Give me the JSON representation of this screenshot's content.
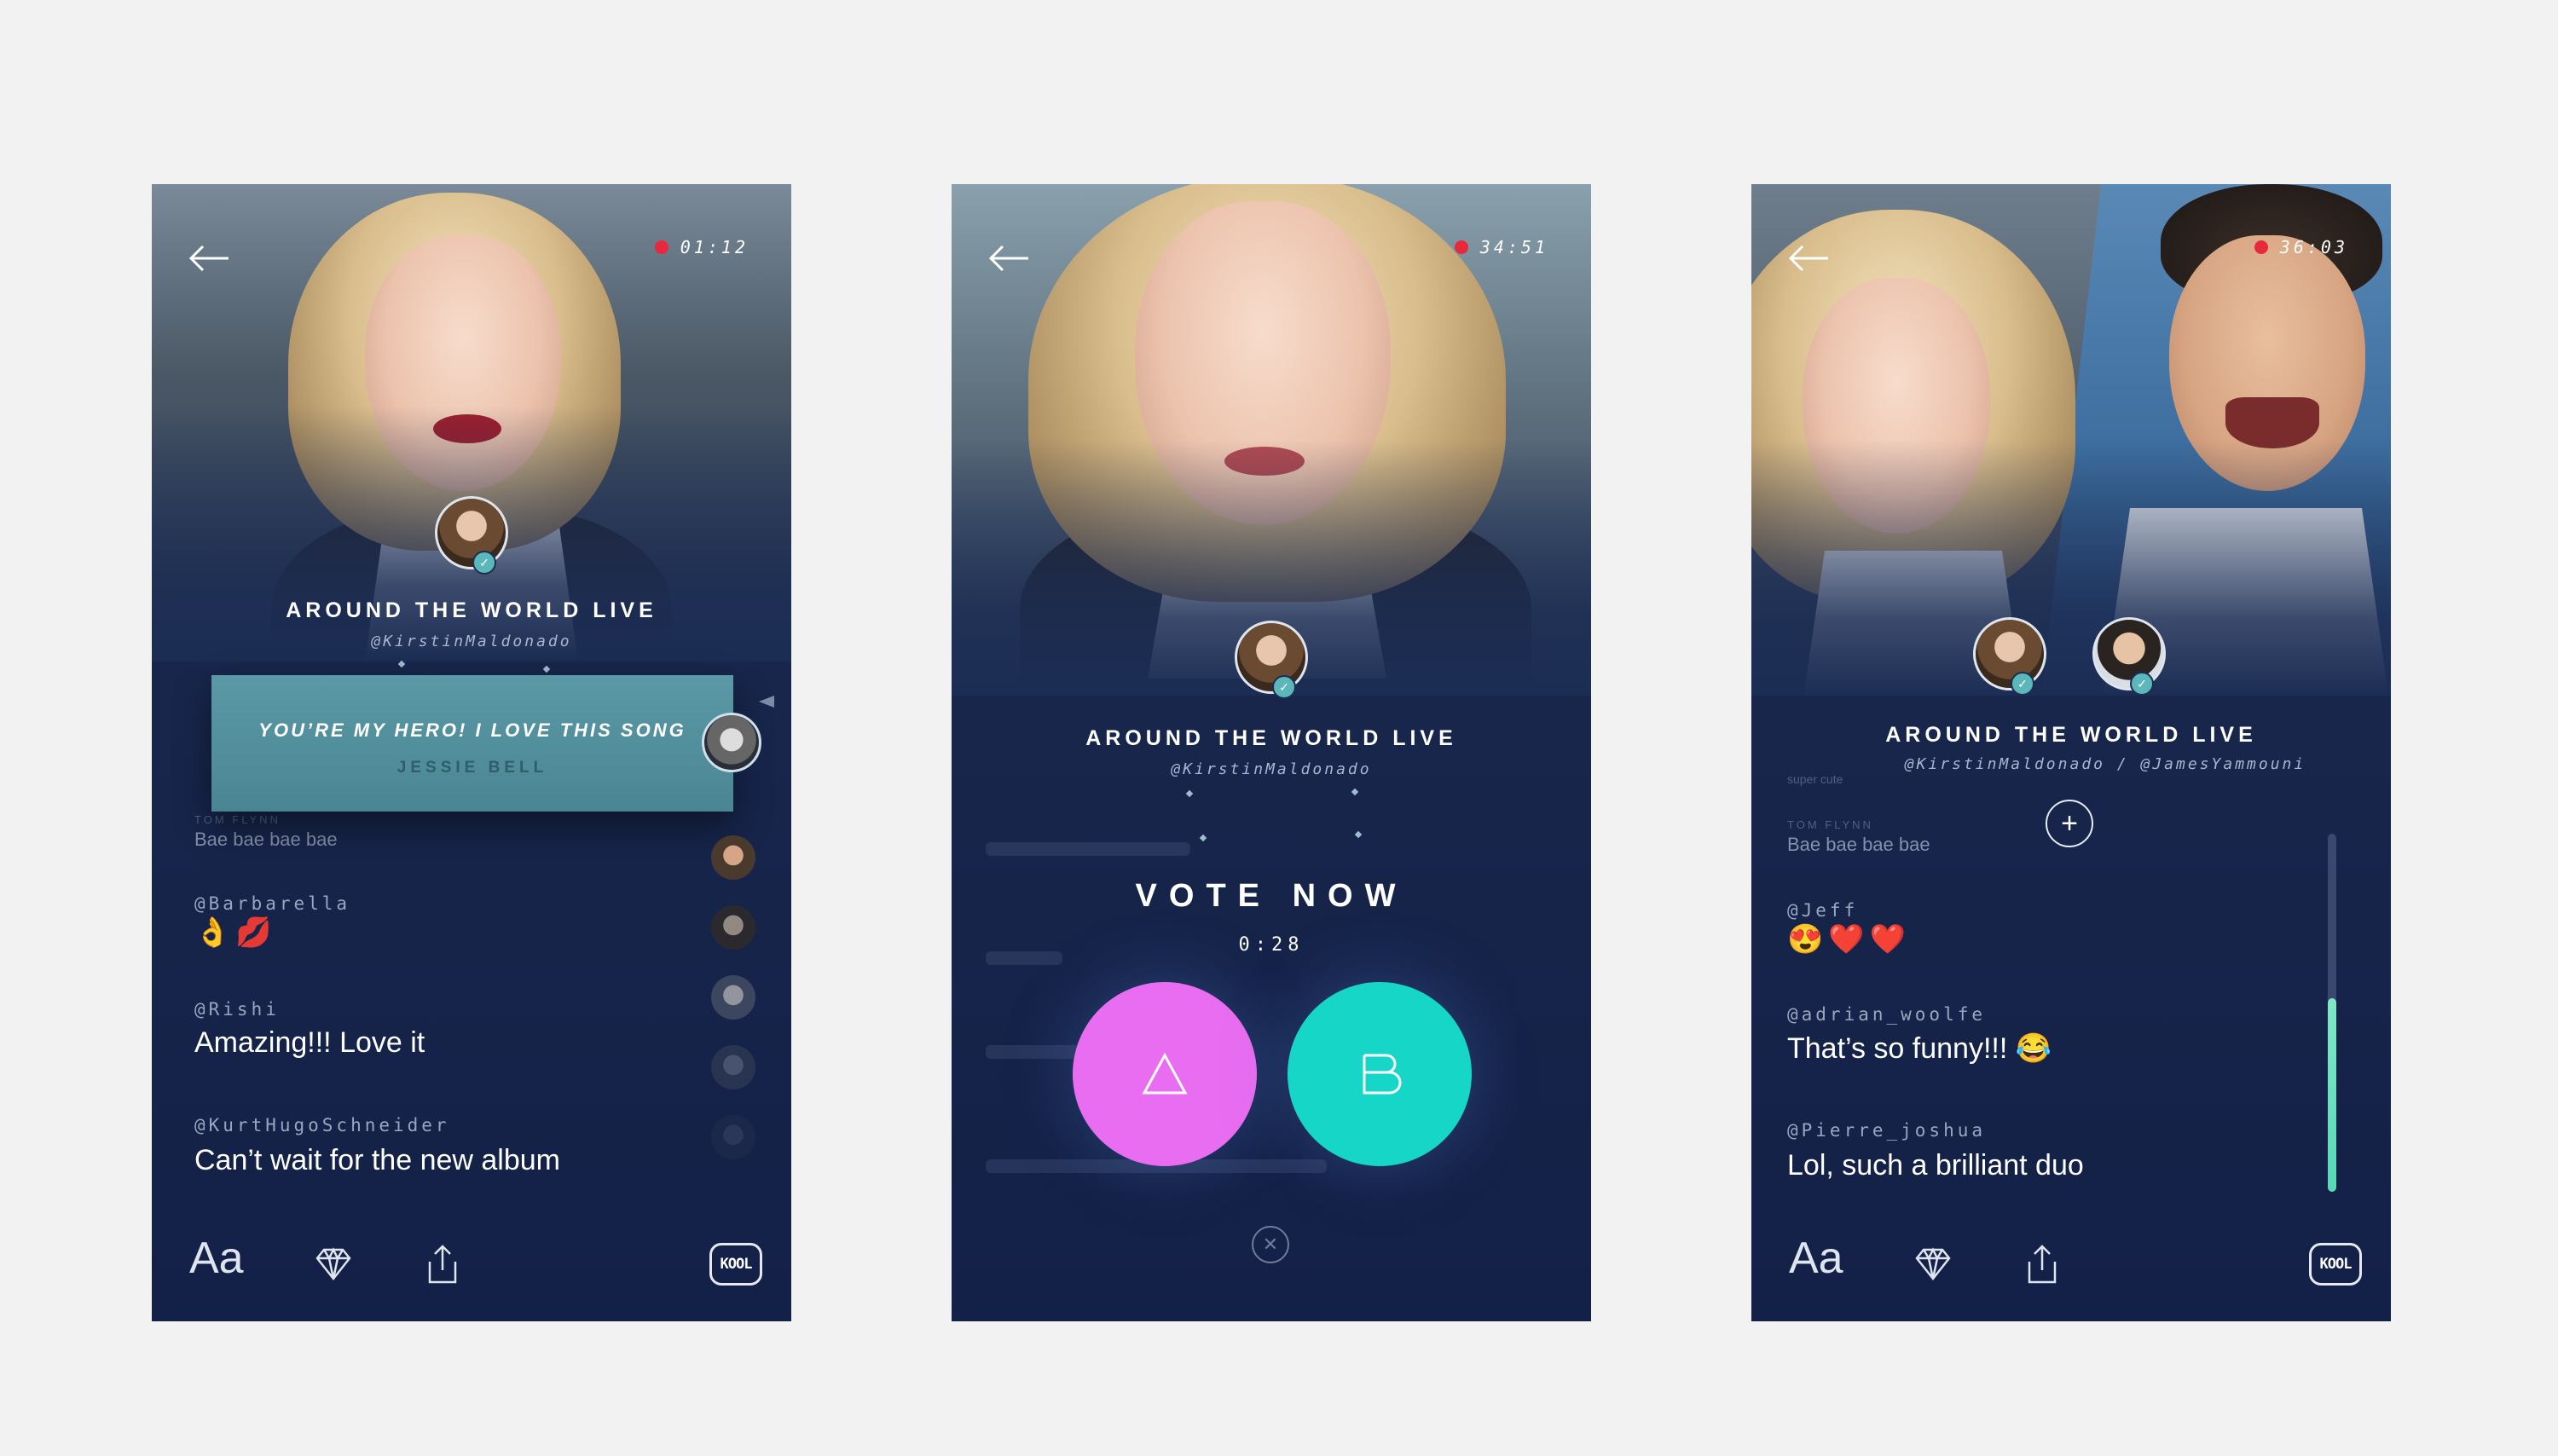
{
  "screens": [
    {
      "live_time": "01:12",
      "show_title": "AROUND THE WORLD LIVE",
      "show_handle": "@KirstinMaldonado",
      "highlight": {
        "message": "YOU’RE MY HERO! I LOVE THIS SONG",
        "author": "JESSIE BELL"
      },
      "faded_user": "TOM FLYNN",
      "faded_text": "Bae bae bae bae",
      "chats": [
        {
          "user": "@Barbarella",
          "emoji": "👌💋"
        },
        {
          "user": "@Rishi",
          "text": "Amazing!!! Love it"
        },
        {
          "user": "@KurtHugoSchneider",
          "text": "Can’t wait for the new album"
        }
      ],
      "bottom": {
        "text_tool": "Aa",
        "kool": "KOOL"
      }
    },
    {
      "live_time": "34:51",
      "show_title": "AROUND THE WORLD LIVE",
      "show_handle": "@KirstinMaldonado",
      "vote": {
        "title": "VOTE NOW",
        "timer": "0:28",
        "option_a": "A",
        "option_b": "B"
      }
    },
    {
      "live_time": "36:03",
      "show_title": "AROUND THE WORLD LIVE",
      "show_handle": "@KirstinMaldonado / @JamesYammouni",
      "faded_text_top": "super cute",
      "faded_user": "TOM FLYNN",
      "faded_text": "Bae bae bae bae",
      "chats": [
        {
          "user": "@Jeff",
          "emoji": "😍❤️❤️"
        },
        {
          "user": "@adrian_woolfe",
          "text": "That’s so funny!!! 😂"
        },
        {
          "user": "@Pierre_joshua",
          "text": "Lol, such a brilliant duo"
        }
      ],
      "bottom": {
        "text_tool": "Aa",
        "kool": "KOOL"
      }
    }
  ],
  "colors": {
    "background": "#f2f2f3",
    "screen": "#1c2d54",
    "live_dot": "#e8283c",
    "vote_a": "#e96df0",
    "vote_b": "#16d6c8",
    "highlight_card": "#5b99a6",
    "progress": "#7fe8c6"
  },
  "progress_level_percent": 54
}
